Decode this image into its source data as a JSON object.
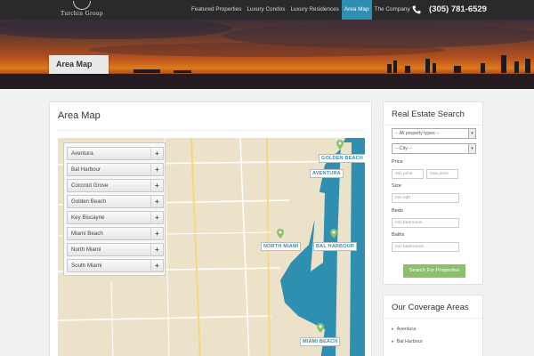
{
  "header": {
    "logo_text": "Turchin Group",
    "nav": [
      {
        "label": "Featured Properties",
        "active": false
      },
      {
        "label": "Luxury Condos",
        "active": false
      },
      {
        "label": "Luxury Residences",
        "active": false
      },
      {
        "label": "Area Map",
        "active": true
      },
      {
        "label": "The Company",
        "active": false
      }
    ],
    "phone": "(305) 781-6529",
    "phone_icon": "phone-icon"
  },
  "hero": {
    "title": "Area Map"
  },
  "main": {
    "title": "Area Map",
    "areas": [
      "Aventura",
      "Bal Harbour",
      "Coconut Grove",
      "Golden Beach",
      "Key Biscayne",
      "Miami Beach",
      "North Miami",
      "South Miami"
    ],
    "map_labels": {
      "golden_beach": "GOLDEN BEACH",
      "aventura": "AVENTURA",
      "north_miami": "NORTH MIAMI",
      "bal_harbour": "BAL HARBOUR",
      "miami_beach": "MIAMI BEACH"
    }
  },
  "search": {
    "title": "Real Estate Search",
    "property_type": "-- All property types --",
    "city": "-- City --",
    "price_label": "Price",
    "min_price_ph": "min price",
    "max_price_ph": "max price",
    "size_label": "Size",
    "min_sqft_ph": "min sqft",
    "beds_label": "Beds",
    "min_beds_ph": "min bedrooms",
    "baths_label": "Baths",
    "min_baths_ph": "min bathrooms",
    "button": "Search For Properties"
  },
  "coverage": {
    "title": "Our Coverage Areas",
    "items": [
      "Aventura",
      "Bal Harbour"
    ]
  },
  "colors": {
    "nav_active": "#2e8fb0",
    "water": "#2e8fb0",
    "button": "#8cc06a",
    "map_land": "#ece2c9"
  }
}
